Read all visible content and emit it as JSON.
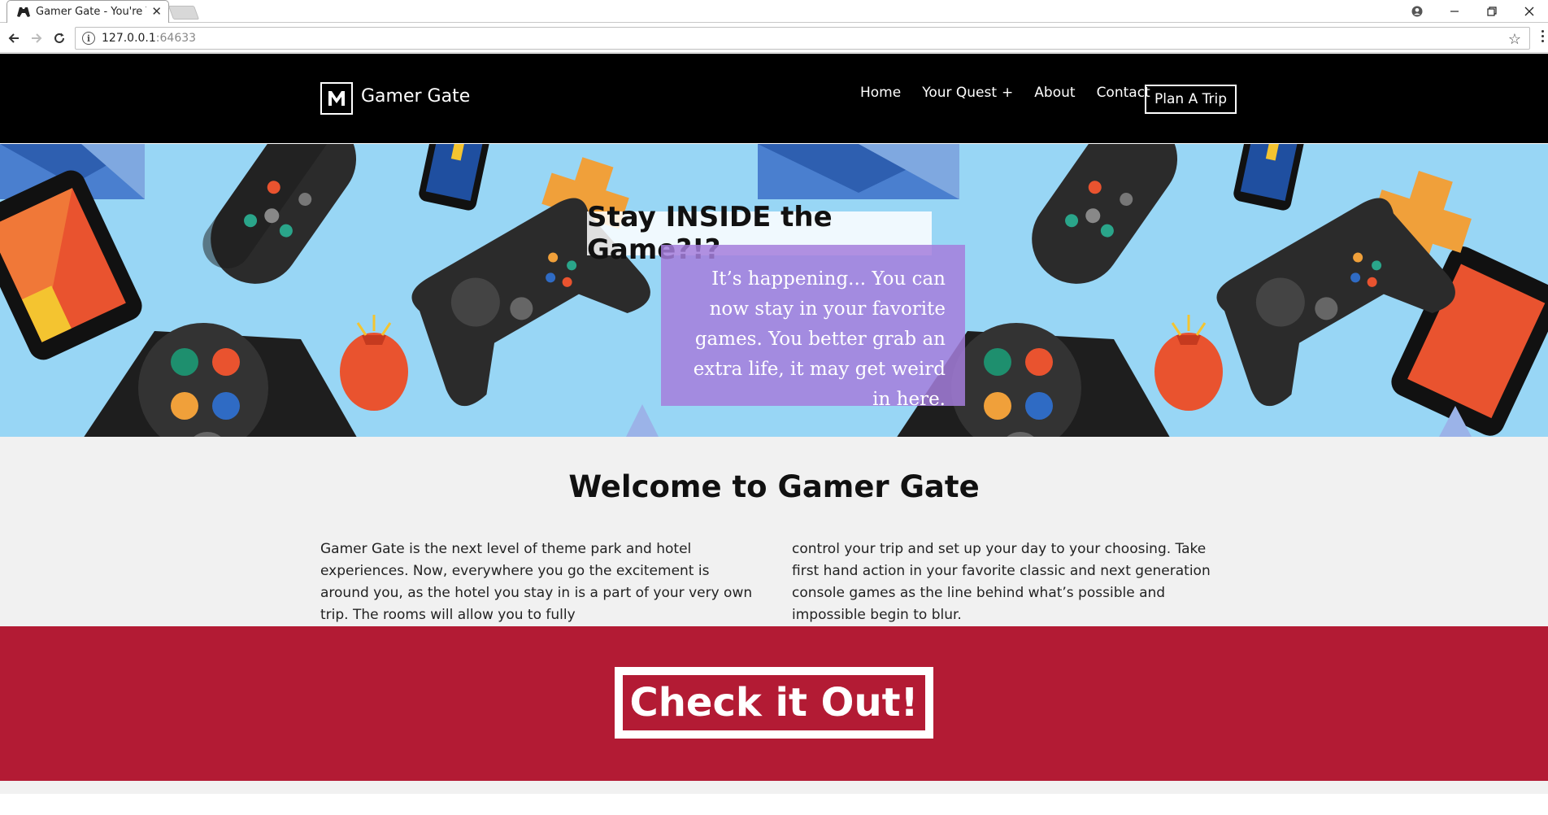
{
  "browser": {
    "tab_title": "Gamer Gate - You're The",
    "url_host": "127.0.0.1",
    "url_port": ":64633"
  },
  "header": {
    "logo_letter": "M",
    "site_name": "Gamer Gate",
    "nav": [
      {
        "label": "Home"
      },
      {
        "label": "Your Quest",
        "suffix": "+"
      },
      {
        "label": "About"
      },
      {
        "label": "Contact"
      }
    ],
    "cta_label": "Plan A Trip"
  },
  "hero": {
    "title": "Stay INSIDE the Game?!?",
    "text": "It’s happening... You can now stay in your favorite games. You better grab an extra life, it may get weird in here."
  },
  "welcome": {
    "heading": "Welcome to Gamer Gate",
    "col1": "Gamer Gate is the next level of theme park and hotel experiences. Now, everywhere you go the excitement is around you, as the hotel you stay in is a part of your very own trip. The rooms will allow you to fully",
    "col2": "control your trip and set up your day to your choosing. Take first hand action in your favorite classic and next generation console games as the line behind what’s possible and impossible begin to blur."
  },
  "cta": {
    "label": "Check it Out!"
  },
  "colors": {
    "header_bg": "#000000",
    "hero_bg": "#98d6f5",
    "hero_text_bg": "#a47edc",
    "welcome_bg": "#f1f1f1",
    "cta_bg": "#b31b34"
  },
  "icons": [
    "gamepad-favicon-icon",
    "back-icon",
    "forward-icon",
    "reload-icon",
    "info-icon",
    "star-icon",
    "menu-icon",
    "account-icon",
    "minimize-icon",
    "restore-icon",
    "close-icon"
  ]
}
